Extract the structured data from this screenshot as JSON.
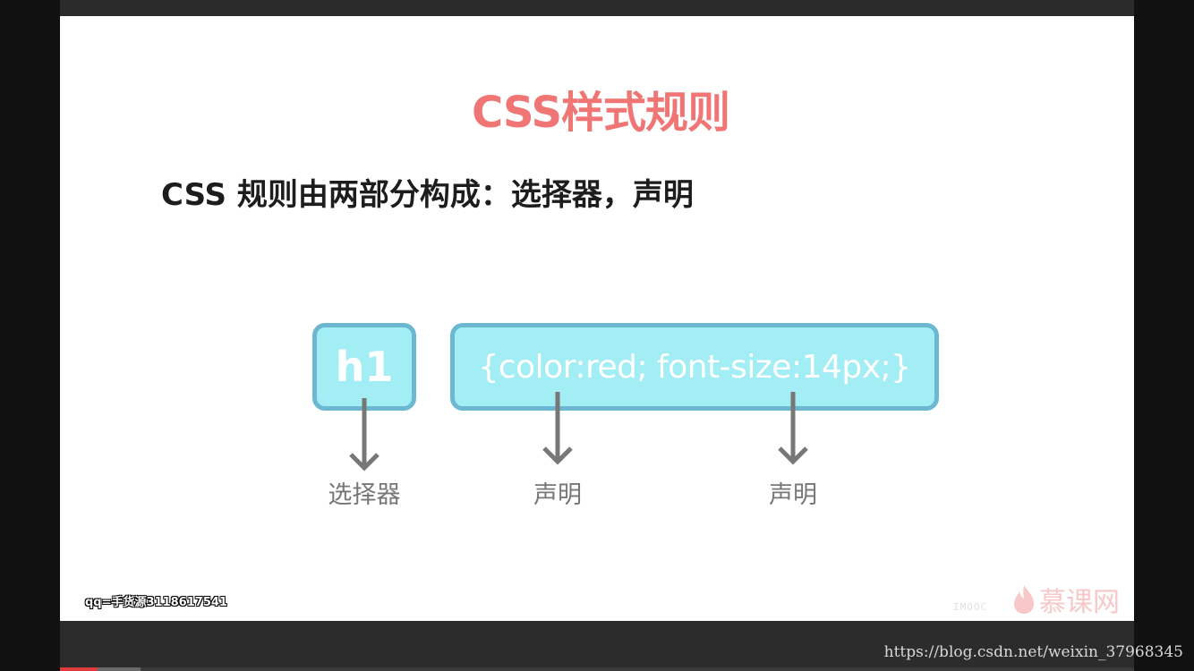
{
  "slide": {
    "title": "CSS样式规则",
    "subtitle": "CSS 规则由两部分构成：选择器，声明",
    "selector_box_text": "h1",
    "declaration_box_text": "{color:red; font-size:14px;}",
    "labels": [
      "选择器",
      "声明",
      "声明"
    ]
  },
  "watermarks": {
    "qq": "qq=手货源3118617541",
    "brand": "慕课网",
    "brand_sub": "IMOOC",
    "url": "https://blog.csdn.net/weixin_37968345"
  },
  "player": {
    "progress_played": 0.035,
    "progress_buffered": 0.075
  },
  "colors": {
    "title": "#f07575",
    "box_fill": "#a3eef4",
    "box_border": "#6cb8d2",
    "arrow": "#777777",
    "progress": "#e03a3a"
  }
}
